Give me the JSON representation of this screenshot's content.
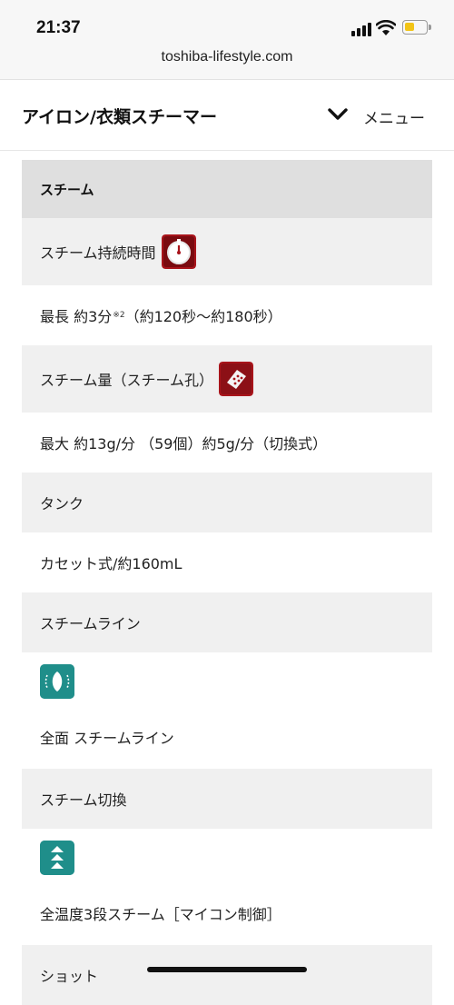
{
  "status": {
    "time": "21:37",
    "url": "toshiba-lifestyle.com",
    "battery_color": "#f2c417"
  },
  "header": {
    "title": "アイロン/衣類スチーマー",
    "menu_label": "メニュー",
    "menu_icon": "chevron-down-icon"
  },
  "section": {
    "title": "スチーム",
    "rows": [
      {
        "label": "スチーム持続時間",
        "icon": "stopwatch-icon",
        "value": "最長 約3分",
        "note": "※2",
        "value_tail": "（約120秒〜約180秒）"
      },
      {
        "label": "スチーム量（スチーム孔）",
        "icon": "steam-hole-icon",
        "value": "最大 約13g/分 （59個）約5g/分（切換式）"
      },
      {
        "label": "タンク",
        "value": "カセット式/約160mL"
      },
      {
        "label": "スチームライン",
        "icon": "steam-line-icon",
        "value": "全面 スチームライン"
      },
      {
        "label": "スチーム切換",
        "icon": "three-level-steam-icon",
        "value": "全温度3段スチーム［マイコン制御］"
      },
      {
        "label": "ショット"
      }
    ]
  },
  "colors": {
    "section_header_bg": "#dfdfdf",
    "row_header_bg": "#f0f0f0",
    "red_icon": "#a8141b",
    "teal_icon": "#1f8e8a"
  }
}
